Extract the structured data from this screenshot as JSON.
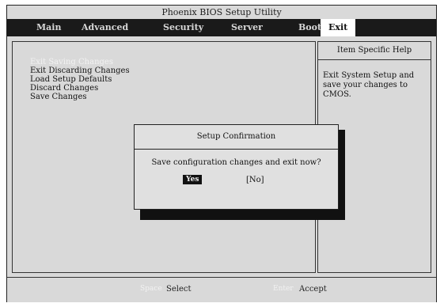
{
  "window": {
    "title": "Phoenix BIOS Setup Utility"
  },
  "menu": {
    "items": [
      {
        "label": "Main"
      },
      {
        "label": "Advanced"
      },
      {
        "label": "Security"
      },
      {
        "label": "Server"
      },
      {
        "label": "Boot"
      },
      {
        "label": "Exit"
      }
    ],
    "selected": "Exit"
  },
  "exit_menu": {
    "items": [
      {
        "label": "Exit Saving Changes",
        "highlighted": true
      },
      {
        "label": "Exit Discarding Changes"
      },
      {
        "label": "Load Setup Defaults"
      },
      {
        "label": "Discard Changes"
      },
      {
        "label": "Save Changes"
      }
    ]
  },
  "help": {
    "title": "Item Specific Help",
    "text": "Exit System Setup and\nsave your changes to\nCMOS."
  },
  "dialog": {
    "title": "Setup Confirmation",
    "message": "Save configuration changes and exit now?",
    "yes_label": "Yes",
    "no_label": "[No]"
  },
  "status_bar": {
    "keys": [
      {
        "key": "Space",
        "action": "Select"
      },
      {
        "key": "Enter",
        "action": "Accept"
      }
    ]
  },
  "colors": {
    "background": "#d9d9d9",
    "menu_bar": "#1a1a1a",
    "dialog_shadow": "#111111",
    "highlight_text": "#f2f2f2"
  }
}
